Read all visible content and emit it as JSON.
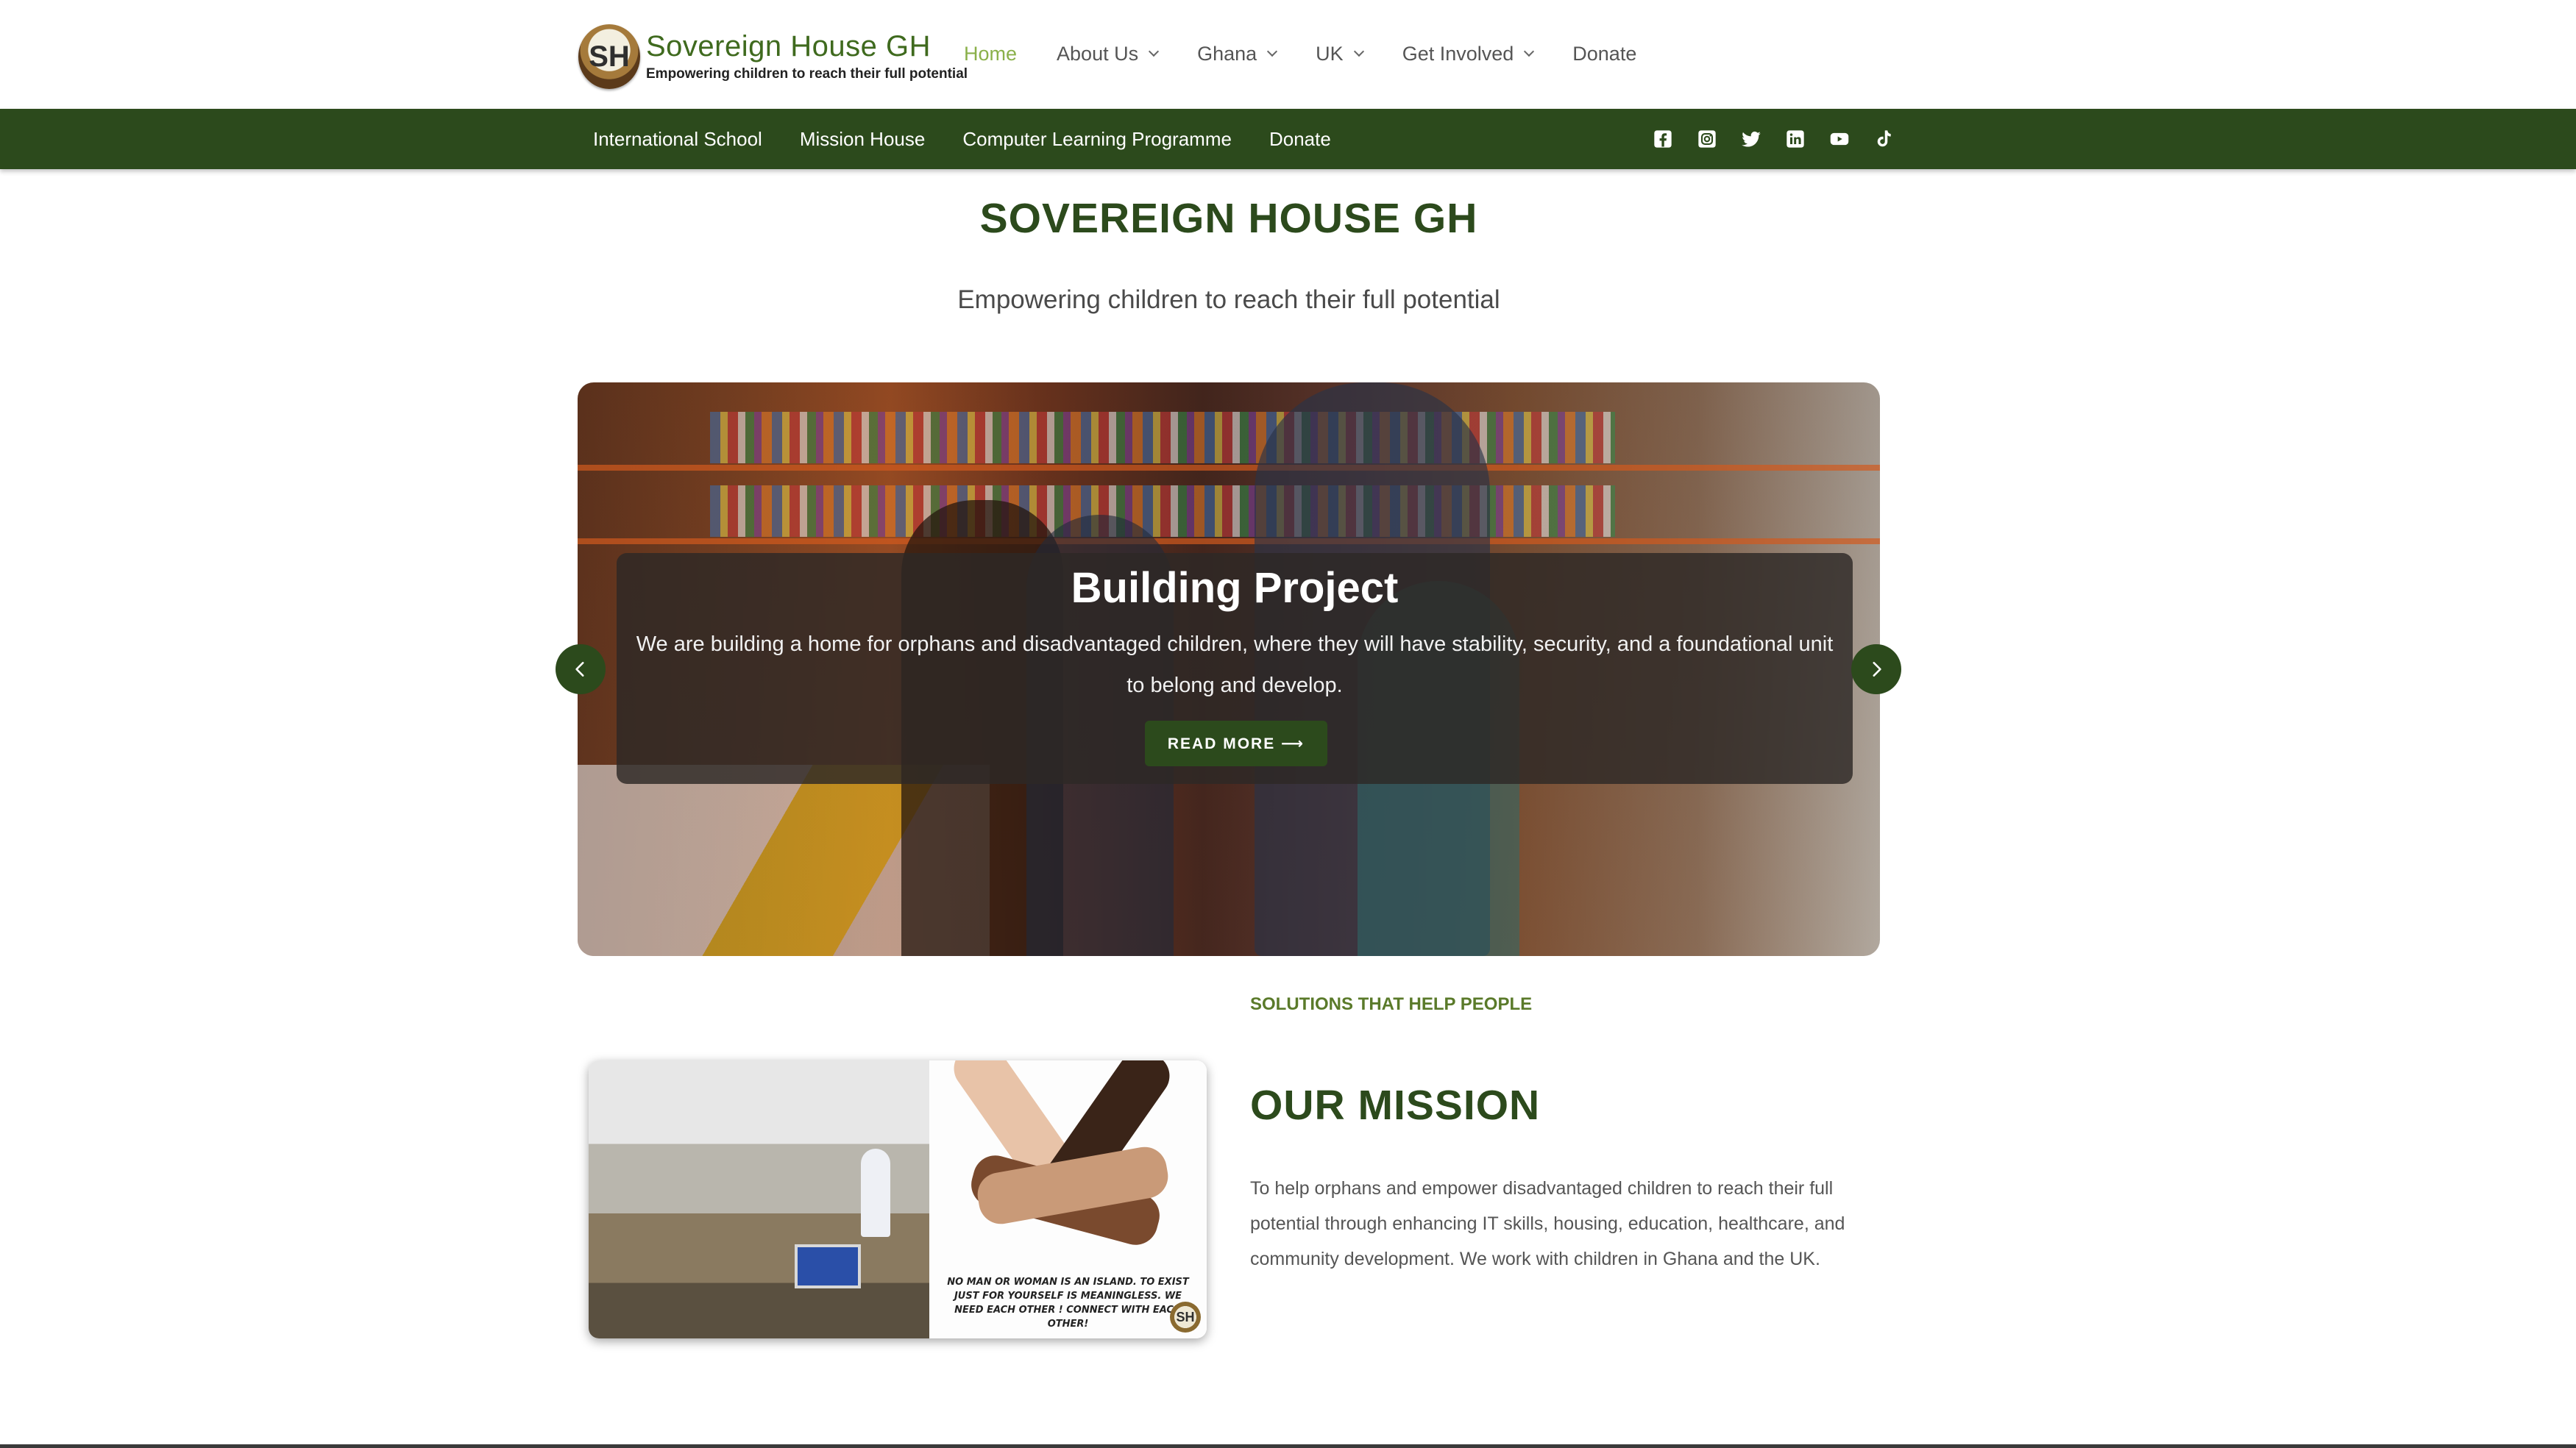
{
  "header": {
    "logo": {
      "badge": "SH",
      "title": "Sovereign House GH",
      "subtitle": "Empowering children to reach their full potential"
    },
    "nav": [
      {
        "label": "Home",
        "active": true,
        "has_dropdown": false
      },
      {
        "label": "About Us",
        "active": false,
        "has_dropdown": true
      },
      {
        "label": "Ghana",
        "active": false,
        "has_dropdown": true
      },
      {
        "label": "UK",
        "active": false,
        "has_dropdown": true
      },
      {
        "label": "Get Involved",
        "active": false,
        "has_dropdown": true
      },
      {
        "label": "Donate",
        "active": false,
        "has_dropdown": false
      }
    ]
  },
  "subbar": {
    "links": [
      "International School",
      "Mission House",
      "Computer Learning Programme",
      "Donate"
    ],
    "social": [
      "facebook-icon",
      "instagram-icon",
      "twitter-icon",
      "linkedin-icon",
      "youtube-icon",
      "tiktok-icon"
    ]
  },
  "hero": {
    "title": "SOVEREIGN HOUSE GH",
    "tagline": "Empowering children to reach their full potential"
  },
  "slider": {
    "slide_title": "Building Project",
    "slide_text": "We are building a home for orphans and disadvantaged children, where they will have stability, security, and a foundational unit to belong and develop.",
    "button_label": "READ MORE ⟶",
    "slide_count": 2,
    "active_slide": 1
  },
  "mission": {
    "eyebrow": "SOLUTIONS THAT HELP PEOPLE",
    "title": "OUR MISSION",
    "text": "To help orphans and empower disadvantaged children to reach their full potential through enhancing IT skills, housing, education, healthcare, and community development. We work with children in Ghana and the UK.",
    "image_quote": "NO MAN OR WOMAN IS AN ISLAND. TO EXIST JUST FOR YOURSELF IS MEANINGLESS. WE NEED EACH OTHER ! CONNECT WITH EACH OTHER!",
    "image_badge": "SH"
  },
  "colors": {
    "brand_green": "#2c4a1c",
    "nav_active": "#8ab04a",
    "eyebrow_green": "#5a7a2a"
  }
}
